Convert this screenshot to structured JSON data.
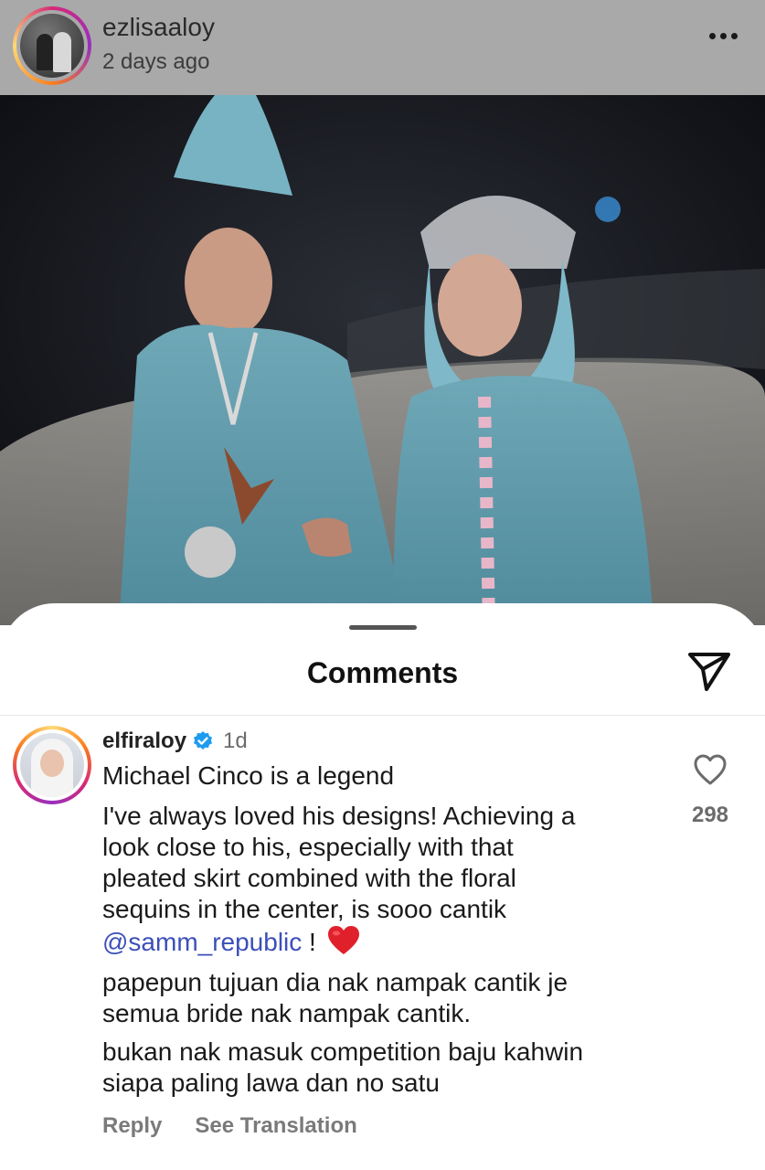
{
  "post": {
    "username": "ezlisaaloy",
    "time": "2 days ago",
    "more_icon": "more-horizontal-icon"
  },
  "sheet": {
    "title": "Comments",
    "send_icon": "paper-plane-icon"
  },
  "comment": {
    "username": "elfiraloy",
    "verified": true,
    "time": "1d",
    "lines": {
      "l1": "Michael Cinco is a legend",
      "l2": "I've always loved his designs! Achieving a",
      "l3": "look close to his, especially with that",
      "l4": "pleated skirt combined with the floral",
      "l5": "sequins in the center, is sooo cantik",
      "l6_mention": "@samm_republic",
      "l6_rest": " !",
      "l7": "papepun tujuan dia nak nampak cantik je",
      "l8": "semua bride nak nampak cantik.",
      "l9": "bukan nak masuk competition baju kahwin",
      "l10": "siapa paling lawa dan no satu"
    },
    "like_count": "298",
    "actions": {
      "reply": "Reply",
      "see_translation": "See Translation"
    }
  },
  "colors": {
    "mention": "#3b4fb8",
    "verified": "#1d9bf0",
    "heart": "#e0202b"
  }
}
